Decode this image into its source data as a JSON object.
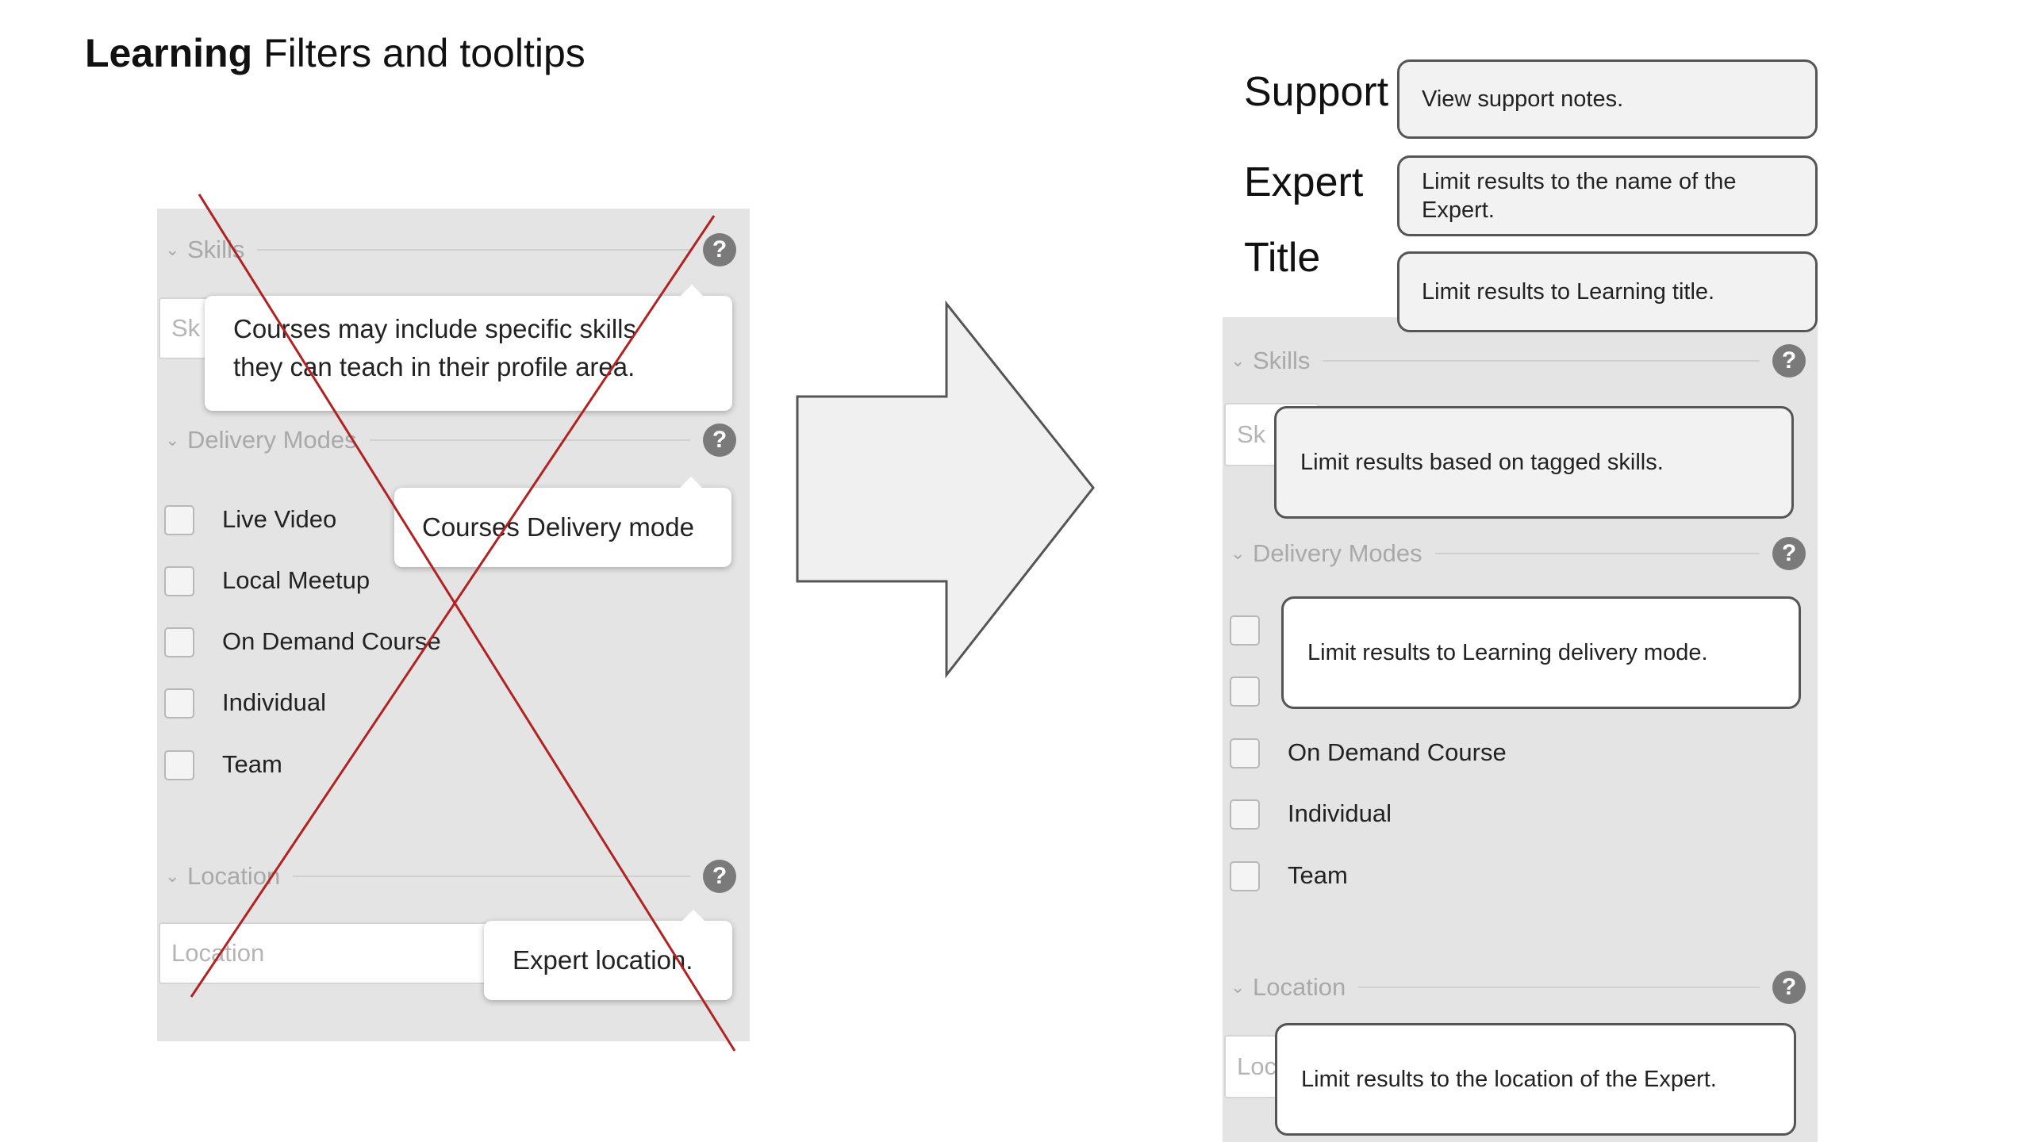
{
  "title": {
    "bold": "Learning",
    "rest": "Filters and tooltips"
  },
  "left_panel": {
    "skills_label": "Skills",
    "skills_input_text": "Sk",
    "skills_tooltip_line1": "Courses may include specific skills",
    "skills_tooltip_line2": "they can teach in their profile area.",
    "delivery_label": "Delivery Modes",
    "delivery_tooltip": "Courses Delivery mode",
    "checkboxes": [
      "Live Video",
      "Local Meetup",
      "On Demand Course",
      "Individual",
      "Team"
    ],
    "location_label": "Location",
    "location_placeholder": "Location",
    "location_tooltip": "Expert location."
  },
  "right_panel": {
    "support_label": "Support",
    "support_note": "View support notes.",
    "expert_label": "Expert",
    "expert_note": "Limit results to the name of the Expert.",
    "title_label": "Title",
    "title_note": "Limit results to Learning title.",
    "skills_label": "Skills",
    "skills_input_text": "Sk",
    "skills_tooltip": "Limit results based on tagged skills.",
    "delivery_label": "Delivery Modes",
    "delivery_tooltip": "Limit results to Learning delivery mode.",
    "checkboxes": [
      "On Demand Course",
      "Individual",
      "Team"
    ],
    "location_label": "Location",
    "location_input_text": "Loc",
    "location_tooltip": "Limit results to the location of the Expert."
  },
  "icons": {
    "help": "question-icon",
    "chevron": "chevron-down-icon",
    "arrow": "right-arrow"
  },
  "colors": {
    "cross": "#b22222",
    "panel": "#e4e4e4",
    "help_icon": "#7a7a7a"
  }
}
